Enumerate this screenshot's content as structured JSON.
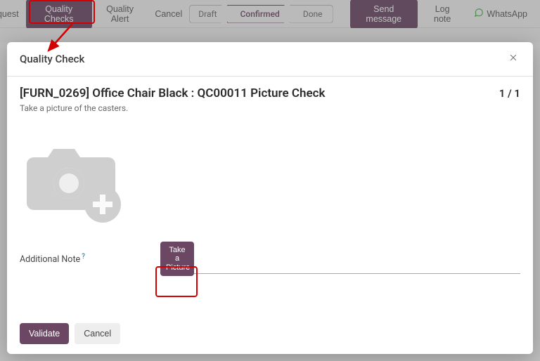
{
  "toolbar": {
    "request": "Request",
    "quality_checks": "Quality Checks",
    "quality_alert": "Quality Alert",
    "cancel": "Cancel",
    "stages": {
      "draft": "Draft",
      "confirmed": "Confirmed",
      "done": "Done"
    },
    "send_message": "Send message",
    "log_note": "Log note",
    "whatsapp": "WhatsApp"
  },
  "modal": {
    "title": "Quality Check",
    "heading": "[FURN_0269] Office Chair Black : QC00011 Picture Check",
    "counter": "1 / 1",
    "subtitle": "Take a picture of the casters.",
    "additional_note_label": "Additional Note",
    "help_mark": "?",
    "take_picture": "Take a Picture",
    "validate": "Validate",
    "cancel": "Cancel"
  }
}
